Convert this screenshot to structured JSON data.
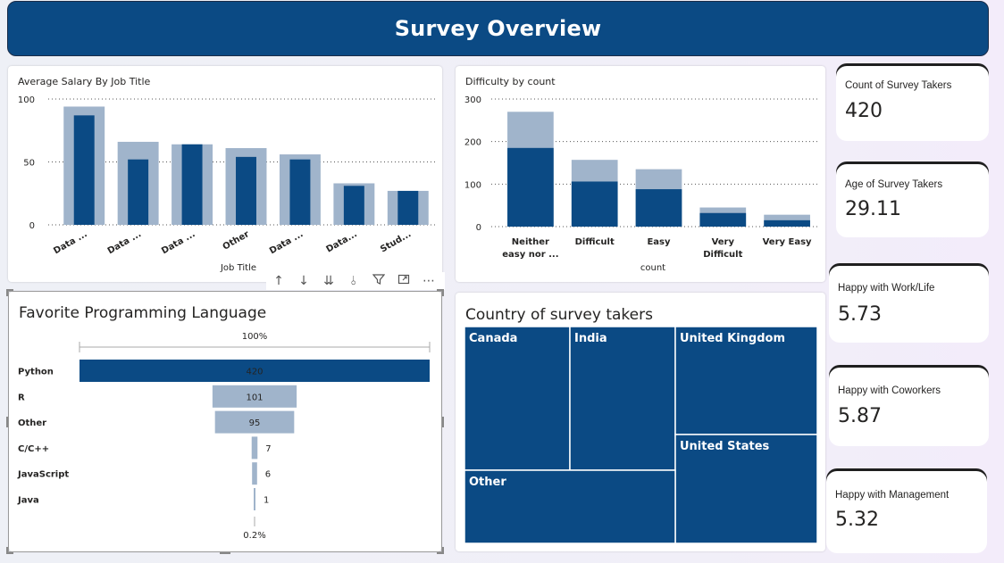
{
  "header": {
    "title": "Survey Overview"
  },
  "toolbar": {
    "icons": [
      "arrow-up-icon",
      "arrow-down-icon",
      "double-arrow-down-icon",
      "hierarchy-icon",
      "filter-icon",
      "focus-mode-icon",
      "more-options-icon"
    ]
  },
  "colors": {
    "dark": "#0b4a84",
    "light": "#a0b4cb",
    "header": "#0b4a84"
  },
  "kpis": [
    {
      "label": "Count of Survey Takers",
      "value": "420"
    },
    {
      "label": "Age of Survey Takers",
      "value": "29.11"
    },
    {
      "label": "Happy with Work/Life",
      "value": "5.73"
    },
    {
      "label": "Happy with Coworkers",
      "value": "5.87"
    },
    {
      "label": "Happy with Management",
      "value": "5.32"
    }
  ],
  "chart_data": [
    {
      "type": "bar",
      "title": "Average Salary By Job Title",
      "xlabel": "Job Title",
      "ylabel": "",
      "ylim": [
        0,
        100
      ],
      "yticks": [
        0,
        50,
        100
      ],
      "categories": [
        "Data ...",
        "Data ...",
        "Data ...",
        "Other",
        "Data ...",
        "Data...",
        "Stud..."
      ],
      "series": [
        {
          "values": [
            94,
            66,
            64,
            61,
            56,
            33,
            27
          ]
        },
        {
          "values": [
            87,
            52,
            64,
            54,
            52,
            31,
            27
          ]
        }
      ],
      "grid": true
    },
    {
      "type": "bar",
      "title": "Difficulty by count",
      "xlabel": "count",
      "ylabel": "",
      "ylim": [
        0,
        300
      ],
      "yticks": [
        0,
        100,
        200,
        300
      ],
      "categories": [
        [
          "Neither",
          "easy nor ..."
        ],
        [
          "Difficult"
        ],
        [
          "Easy"
        ],
        [
          "Very",
          "Difficult"
        ],
        [
          "Very Easy"
        ]
      ],
      "series": [
        {
          "values": [
            270,
            157,
            135,
            45,
            28
          ]
        },
        {
          "values": [
            185,
            106,
            88,
            32,
            15
          ]
        }
      ],
      "grid": true
    },
    {
      "type": "funnel",
      "title": "Favorite Programming Language",
      "top_label": "100%",
      "bottom_label": "0.2%",
      "categories": [
        "Python",
        "R",
        "Other",
        "C/C++",
        "JavaScript",
        "Java"
      ],
      "values": [
        420,
        101,
        95,
        7,
        6,
        1
      ]
    },
    {
      "type": "treemap",
      "title": "Country of survey takers",
      "categories": [
        "Canada",
        "India",
        "United Kingdom",
        "United States",
        "Other"
      ]
    }
  ]
}
